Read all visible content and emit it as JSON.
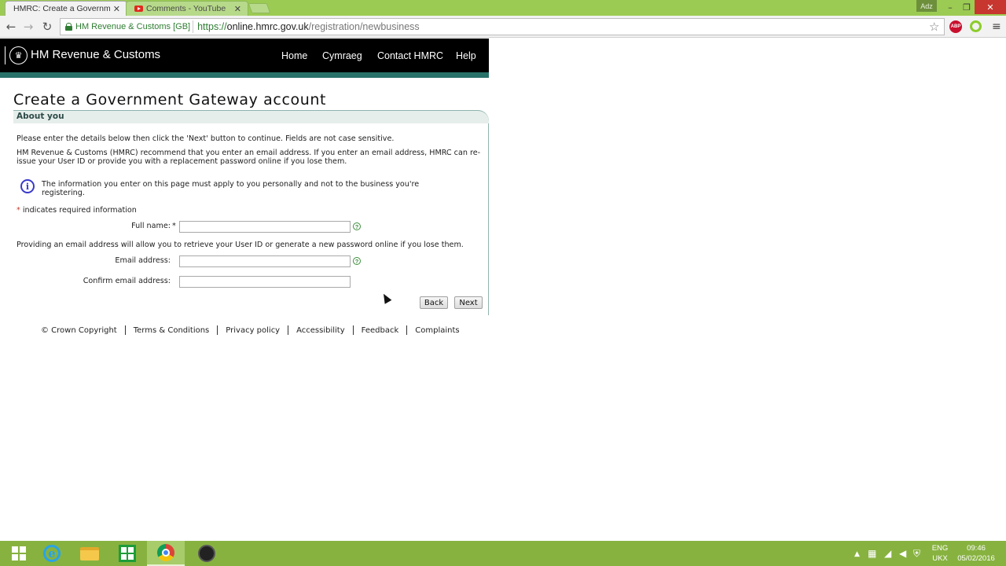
{
  "browser": {
    "tabs": [
      {
        "title": "HMRC: Create a Governm",
        "close": "✕"
      },
      {
        "title": "Comments - YouTube",
        "close": "✕"
      }
    ],
    "profile_badge": "Adz",
    "window_controls": {
      "minimize": "–",
      "maximize": "❐",
      "close": "✕"
    },
    "ev_badge": "HM Revenue & Customs [GB]",
    "url_scheme": "https://",
    "url_host": "online.hmrc.gov.uk",
    "url_path": "/registration/newbusiness",
    "abp_label": "ABP"
  },
  "hmrc": {
    "brand": "HM Revenue & Customs",
    "nav": [
      "Home",
      "Cymraeg",
      "Contact HMRC",
      "Help"
    ]
  },
  "page": {
    "title": "Create a Government Gateway account",
    "section": "About you",
    "intro": "Please enter the details below then click the 'Next' button to continue. Fields are not case sensitive.",
    "email_recommend_1": "HM Revenue & Customs (HMRC) recommend that you enter an email address. If you enter an email address, HMRC can re-",
    "email_recommend_2": "issue your User ID or provide you with a replacement password online if you lose them.",
    "info_1": "The information you enter on this page must apply to you personally and not to the business you're",
    "info_2": "registering.",
    "required_marker": "*",
    "required_text": " indicates required information",
    "full_name_label": "Full name:",
    "full_name_value": "",
    "email_note": "Providing an email address will allow you to retrieve your User ID or generate a new password online if you lose them.",
    "email_label": "Email address:",
    "email_value": "",
    "confirm_email_label": "Confirm email address:",
    "confirm_email_value": "",
    "help_glyph": "?",
    "info_glyph": "i",
    "back_label": "Back",
    "next_label": "Next"
  },
  "footer": {
    "links": [
      "© Crown Copyright",
      "Terms & Conditions",
      "Privacy policy",
      "Accessibility",
      "Feedback",
      "Complaints"
    ]
  },
  "taskbar": {
    "lang_1": "ENG",
    "lang_2": "UKX",
    "time": "09:46",
    "date": "05/02/2016"
  }
}
